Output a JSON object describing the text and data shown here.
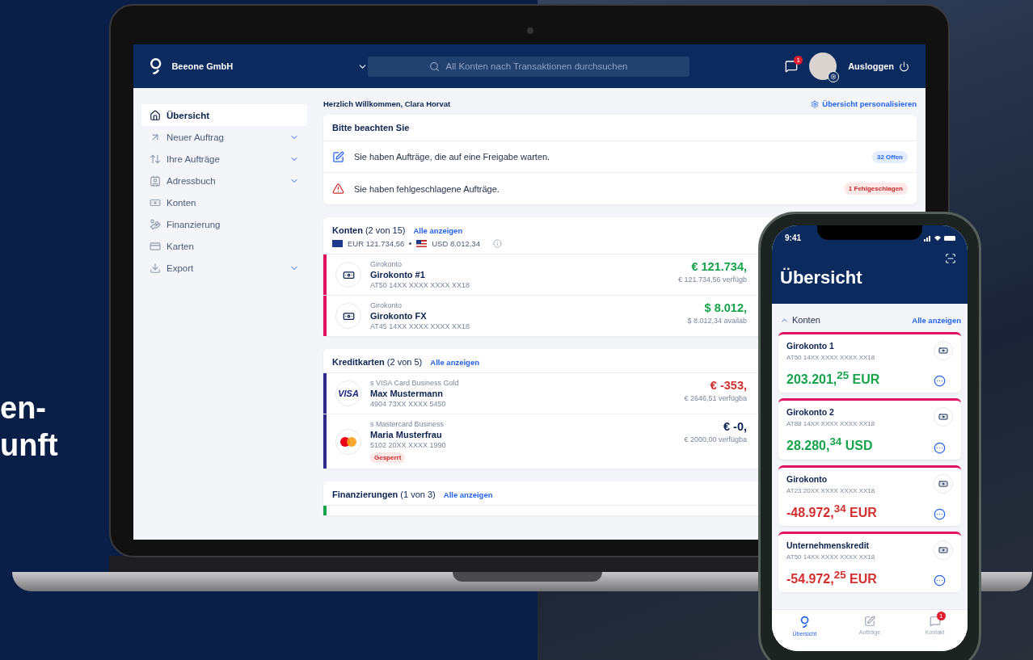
{
  "headline": [
    "en-",
    "unft"
  ],
  "laptop": {
    "header": {
      "company": "Beeone GmbH",
      "search_placeholder": "All Konten nach Transaktionen durchsuchen",
      "notification_count": "1",
      "logout": "Ausloggen"
    },
    "sidebar": [
      {
        "label": "Übersicht",
        "selected": true,
        "expandable": false
      },
      {
        "label": "Neuer Auftrag",
        "selected": false,
        "expandable": true
      },
      {
        "label": "Ihre Aufträge",
        "selected": false,
        "expandable": true
      },
      {
        "label": "Adressbuch",
        "selected": false,
        "expandable": true
      },
      {
        "label": "Konten",
        "selected": false,
        "expandable": false
      },
      {
        "label": "Finanzierung",
        "selected": false,
        "expandable": false
      },
      {
        "label": "Karten",
        "selected": false,
        "expandable": false
      },
      {
        "label": "Export",
        "selected": false,
        "expandable": true
      }
    ],
    "welcome": "Herzlich Willkommen, Clara Horvat",
    "personalize": "Übersicht personalisieren",
    "notice": {
      "title": "Bitte beachten Sie",
      "items": [
        {
          "kind": "pending",
          "text": "Sie haben Aufträge, die auf eine Freigabe warten.",
          "badge": "32 Offen"
        },
        {
          "kind": "failed",
          "text": "Sie haben fehlgeschlagene Aufträge.",
          "badge": "1 Fehlgeschlagen"
        }
      ]
    },
    "sections": [
      {
        "title": "Konten",
        "count": "(2 von 15)",
        "link": "Alle anzeigen",
        "color": "#e0115f",
        "totals": [
          {
            "kind": "eu",
            "text": "EUR 121.734,56"
          },
          {
            "kind": "us",
            "text": "USD 8.012,34"
          }
        ],
        "rows": [
          {
            "kind": "account",
            "type": "Girokonto",
            "name": "Girokonto #1",
            "number": "AT50 14XX XXXX XXXX XX18",
            "amount": "€ 121.734,",
            "available": "€ 121.734,56 verfügb",
            "color": "#16a34a"
          },
          {
            "kind": "account",
            "type": "Girokonto",
            "name": "Girokonto FX",
            "number": "AT45 14XX XXXX XXXX XX18",
            "amount": "$ 8.012,",
            "available": "$ 8.012,34 availab",
            "color": "#16a34a"
          }
        ]
      },
      {
        "title": "Kreditkarten",
        "count": "(2 von 5)",
        "link": "Alle anzeigen",
        "color": "#2e2a8c",
        "rows": [
          {
            "kind": "visa",
            "brand": "VISA",
            "type": "s VISA Card Business Gold",
            "name": "Max Mustermann",
            "number": "4904 73XX XXXX 5450",
            "amount": "€ -353,",
            "available": "€ 2646,51 verfügba",
            "color": "#d32f2f"
          },
          {
            "kind": "mastercard",
            "type": "s Mastercard Business",
            "name": "Maria Musterfrau",
            "number": "5102 20XX XXXX 1990",
            "amount": "€ -0,",
            "available": "€ 2000,00 verfügba",
            "color": "#0b2350",
            "status": "Gesperrt"
          }
        ]
      },
      {
        "title": "Finanzierungen",
        "count": "(1 von 3)",
        "link": "Alle anzeigen",
        "color": "#16a34a"
      }
    ]
  },
  "phone": {
    "time": "9:41",
    "title": "Übersicht",
    "section": "Konten",
    "expanded": true,
    "link": "Alle anzeigen",
    "cards": [
      {
        "name": "Girokonto 1",
        "number": "AT50 14XX XXXX XXXX XX18",
        "amount": "203.201,$^{25}$ EUR",
        "color": "#16a34a"
      },
      {
        "name": "Girokonto 2",
        "number": "AT88 14XX XXXX XXXX XX18",
        "amount": "28.280,$^{34}$ USD",
        "color": "#16a34a"
      },
      {
        "name": "Girokonto",
        "number": "AT23 20XX XXXX XXXX XX18",
        "amount": "-48.972,$^{34}$ EUR",
        "color": "#d32f2f"
      },
      {
        "name": "Unternehmenskredit",
        "number": "AT50 14XX XXXX XXXX XX18",
        "amount": "-54.972,$^{25}$ EUR",
        "color": "#d32f2f"
      }
    ],
    "tabs": [
      {
        "label": "Übersicht",
        "selected": true
      },
      {
        "label": "Aufträge",
        "selected": false
      },
      {
        "label": "Kontakt",
        "selected": false,
        "badge": "1"
      }
    ]
  }
}
